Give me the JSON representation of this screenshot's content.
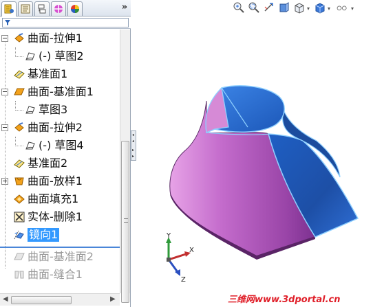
{
  "panel": {
    "tabs": [
      {
        "name": "feature-manager",
        "active": true
      },
      {
        "name": "property-manager"
      },
      {
        "name": "configuration-manager"
      },
      {
        "name": "dimxpert-manager"
      },
      {
        "name": "display-manager"
      }
    ],
    "more_label": "»",
    "filter_icon": "funnel-icon"
  },
  "tree": {
    "items": [
      {
        "label": "曲面-拉伸1",
        "icon": "surface-extrude-icon",
        "expander": "minus"
      },
      {
        "label": "(-) 草图2",
        "icon": "sketch-icon",
        "child": true
      },
      {
        "label": "基准面1",
        "icon": "plane-icon"
      },
      {
        "label": "曲面-基准面1",
        "icon": "planar-surface-icon",
        "expander": "minus"
      },
      {
        "label": "草图3",
        "icon": "sketch-icon",
        "child": true
      },
      {
        "label": "曲面-拉伸2",
        "icon": "surface-extrude-icon",
        "expander": "minus"
      },
      {
        "label": "(-) 草图4",
        "icon": "sketch-icon",
        "child": true
      },
      {
        "label": "基准面2",
        "icon": "plane-icon"
      },
      {
        "label": "曲面-放样1",
        "icon": "surface-loft-icon",
        "expander": "plus"
      },
      {
        "label": "曲面填充1",
        "icon": "filled-surface-icon"
      },
      {
        "label": "实体-删除1",
        "icon": "delete-body-icon"
      },
      {
        "label": "镜向1",
        "icon": "mirror-icon",
        "selected": true
      },
      {
        "label": "曲面-基准面2",
        "icon": "planar-surface-icon",
        "suppressed": true
      },
      {
        "label": "曲面-缝合1",
        "icon": "knit-surface-icon",
        "suppressed": true
      }
    ]
  },
  "hud": {
    "icons": [
      "zoom-to-fit-icon",
      "zoom-to-area-icon",
      "previous-view-icon",
      "section-view-icon",
      "view-orientation-icon",
      "display-style-icon",
      "hide-show-items-icon"
    ]
  },
  "triad": {
    "x_label": "X",
    "y_label": "Y",
    "z_label": "Z"
  },
  "watermark": "三维网www.3dportal.cn",
  "colors": {
    "selection": "#3399ff",
    "surface_magenta": "#c070c8",
    "surface_blue": "#2f6fd0",
    "edge_highlight": "#6fc3ff",
    "watermark": "#e0202a"
  }
}
